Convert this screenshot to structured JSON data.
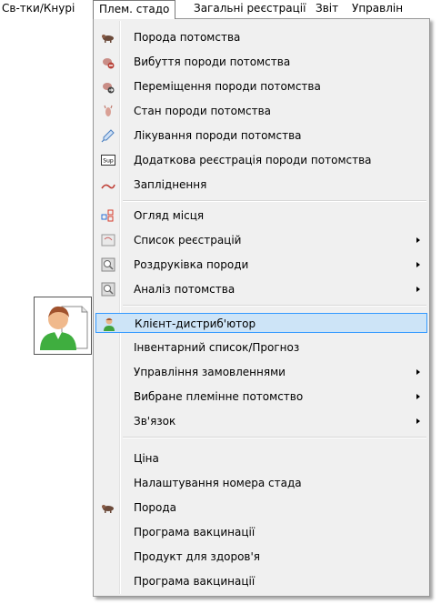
{
  "menubar": {
    "items": [
      {
        "label": "Св-тки/Кнурі"
      },
      {
        "label": "Плем. стадо"
      },
      {
        "label": "Загальні реєстрації"
      },
      {
        "label": "Звіт"
      },
      {
        "label": "Управлін"
      }
    ]
  },
  "menu": {
    "items": [
      {
        "label": "Порода потомства",
        "icon": "pig-icon"
      },
      {
        "label": "Вибуття породи потомства",
        "icon": "pig-remove-icon"
      },
      {
        "label": "Переміщення породи потомства",
        "icon": "pig-move-icon"
      },
      {
        "label": "Стан породи потомства",
        "icon": "pig-status-icon"
      },
      {
        "label": "Лікування породи потомства",
        "icon": "syringe-icon"
      },
      {
        "label": "Додаткова реєстрація породи потомства",
        "icon": "sup-icon"
      },
      {
        "label": "Запліднення",
        "icon": "insemination-icon"
      },
      {
        "label": "Огляд місця",
        "icon": "location-grid-icon"
      },
      {
        "label": "Список реєстрацій",
        "icon": "list-icon"
      },
      {
        "label": "Роздруківка породи",
        "icon": "print-icon"
      },
      {
        "label": "Аналіз потомства",
        "icon": "analysis-icon"
      },
      {
        "label": "Клієнт-дистриб'ютор",
        "icon": "client-icon"
      },
      {
        "label": "Інвентарний список/Прогноз",
        "icon": ""
      },
      {
        "label": "Управління замовленнями",
        "icon": ""
      },
      {
        "label": "Вибране племінне потомство",
        "icon": ""
      },
      {
        "label": "Зв'язок",
        "icon": ""
      },
      {
        "label": "Ціна",
        "icon": ""
      },
      {
        "label": "Налаштування номера стада",
        "icon": ""
      },
      {
        "label": "Порода",
        "icon": "pig-icon"
      },
      {
        "label": "Програма вакцинації",
        "icon": ""
      },
      {
        "label": "Продукт для здоров'я",
        "icon": ""
      },
      {
        "label": "Програма вакцинації",
        "icon": ""
      }
    ]
  },
  "colors": {
    "highlight_bg": "#cde4f7",
    "highlight_border": "#3399ff",
    "menu_bg": "#f0f0f0"
  }
}
